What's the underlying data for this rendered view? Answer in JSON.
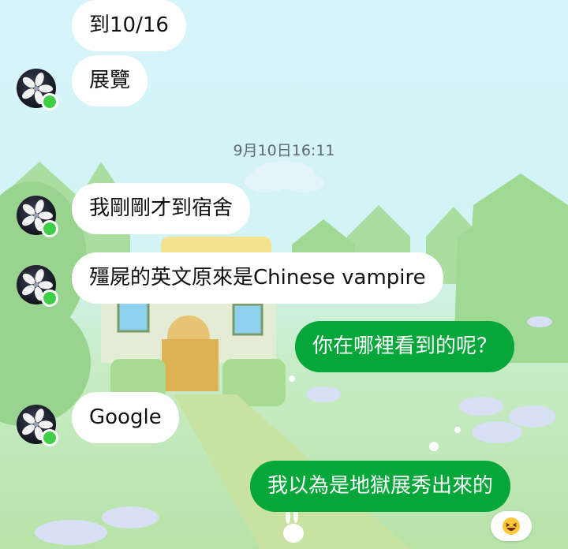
{
  "chat": {
    "messages": [
      {
        "side": "in",
        "text": "到10/16"
      },
      {
        "side": "in",
        "text": "展覽"
      },
      {
        "side": "in",
        "text": "我剛剛才到宿舍"
      },
      {
        "side": "in",
        "text": "殭屍的英文原來是Chinese vampire"
      },
      {
        "side": "out",
        "text": "你在哪裡看到的呢？"
      },
      {
        "side": "in",
        "text": "Google"
      },
      {
        "side": "out",
        "text": "我以為是地獄展秀出來的"
      }
    ],
    "timestamp": "9月10日16:11",
    "reaction_icon": "laughing-emoji-icon",
    "avatar_icon": "bauhinia-flag-avatar",
    "colors": {
      "outgoing_bubble": "#06a73a",
      "incoming_bubble": "#ffffff",
      "online_indicator": "#3fcf46"
    }
  }
}
